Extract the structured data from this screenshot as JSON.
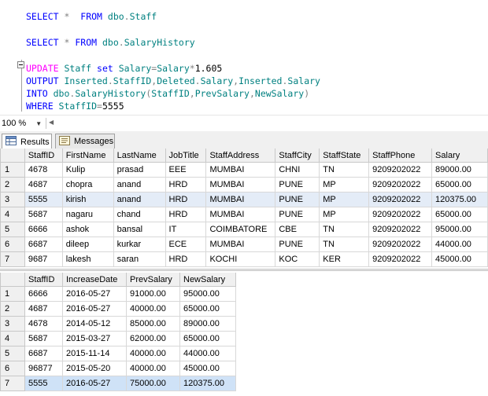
{
  "editor": {
    "lines": [
      {
        "segments": [
          {
            "t": "SELECT ",
            "c": "kw"
          },
          {
            "t": "*",
            "c": "gray"
          },
          {
            "t": "  ",
            "c": ""
          },
          {
            "t": "FROM",
            "c": "kw"
          },
          {
            "t": " dbo",
            "c": "obj"
          },
          {
            "t": ".",
            "c": "gray"
          },
          {
            "t": "Staff",
            "c": "obj"
          }
        ]
      },
      {
        "segments": []
      },
      {
        "segments": [
          {
            "t": "SELECT ",
            "c": "kw"
          },
          {
            "t": "*",
            "c": "gray"
          },
          {
            "t": " ",
            "c": ""
          },
          {
            "t": "FROM",
            "c": "kw"
          },
          {
            "t": " dbo",
            "c": "obj"
          },
          {
            "t": ".",
            "c": "gray"
          },
          {
            "t": "SalaryHistory",
            "c": "obj"
          }
        ]
      },
      {
        "segments": []
      },
      {
        "segments": [
          {
            "t": "UPDATE",
            "c": "pink"
          },
          {
            "t": " Staff ",
            "c": "obj"
          },
          {
            "t": "set",
            "c": "kw"
          },
          {
            "t": " Salary",
            "c": "obj"
          },
          {
            "t": "=",
            "c": "gray"
          },
          {
            "t": "Salary",
            "c": "obj"
          },
          {
            "t": "*",
            "c": "gray"
          },
          {
            "t": "1.605",
            "c": ""
          }
        ]
      },
      {
        "segments": [
          {
            "t": "OUTPUT",
            "c": "kw"
          },
          {
            "t": " Inserted",
            "c": "obj"
          },
          {
            "t": ".",
            "c": "gray"
          },
          {
            "t": "StaffID",
            "c": "obj"
          },
          {
            "t": ",",
            "c": "gray"
          },
          {
            "t": "Deleted",
            "c": "obj"
          },
          {
            "t": ".",
            "c": "gray"
          },
          {
            "t": "Salary",
            "c": "obj"
          },
          {
            "t": ",",
            "c": "gray"
          },
          {
            "t": "Inserted",
            "c": "obj"
          },
          {
            "t": ".",
            "c": "gray"
          },
          {
            "t": "Salary",
            "c": "obj"
          }
        ]
      },
      {
        "segments": [
          {
            "t": "INTO",
            "c": "kw"
          },
          {
            "t": " dbo",
            "c": "obj"
          },
          {
            "t": ".",
            "c": "gray"
          },
          {
            "t": "SalaryHistory",
            "c": "obj"
          },
          {
            "t": "(",
            "c": "gray"
          },
          {
            "t": "StaffID",
            "c": "obj"
          },
          {
            "t": ",",
            "c": "gray"
          },
          {
            "t": "PrevSalary",
            "c": "obj"
          },
          {
            "t": ",",
            "c": "gray"
          },
          {
            "t": "NewSalary",
            "c": "obj"
          },
          {
            "t": ")",
            "c": "gray"
          }
        ]
      },
      {
        "segments": [
          {
            "t": "WHERE",
            "c": "kw"
          },
          {
            "t": " StaffID",
            "c": "obj"
          },
          {
            "t": "=",
            "c": "gray"
          },
          {
            "t": "5555",
            "c": ""
          }
        ]
      }
    ]
  },
  "zoom": {
    "value": "100 %"
  },
  "tabs": {
    "results": "Results",
    "messages": "Messages"
  },
  "grid1": {
    "columns": [
      "StaffID",
      "FirstName",
      "LastName",
      "JobTitle",
      "StaffAddress",
      "StaffCity",
      "StaffState",
      "StaffPhone",
      "Salary"
    ],
    "rows": [
      [
        "1",
        "4678",
        "Kulip",
        "prasad",
        "EEE",
        "MUMBAI",
        "CHNI",
        "TN",
        "9209202022",
        "89000.00"
      ],
      [
        "2",
        "4687",
        "chopra",
        "anand",
        "HRD",
        "MUMBAI",
        "PUNE",
        "MP",
        "9209202022",
        "65000.00"
      ],
      [
        "3",
        "5555",
        "kirish",
        "anand",
        "HRD",
        "MUMBAI",
        "PUNE",
        "MP",
        "9209202022",
        "120375.00"
      ],
      [
        "4",
        "5687",
        "nagaru",
        "chand",
        "HRD",
        "MUMBAI",
        "PUNE",
        "MP",
        "9209202022",
        "65000.00"
      ],
      [
        "5",
        "6666",
        "ashok",
        "bansal",
        "IT",
        "COIMBATORE",
        "CBE",
        "TN",
        "9209202022",
        "95000.00"
      ],
      [
        "6",
        "6687",
        "dileep",
        "kurkar",
        "ECE",
        "MUMBAI",
        "PUNE",
        "TN",
        "9209202022",
        "44000.00"
      ],
      [
        "7",
        "9687",
        "lakesh",
        "saran",
        "HRD",
        "KOCHI",
        "KOC",
        "KER",
        "9209202022",
        "45000.00"
      ]
    ]
  },
  "grid2": {
    "columns": [
      "StaffID",
      "IncreaseDate",
      "PrevSalary",
      "NewSalary"
    ],
    "rows": [
      [
        "1",
        "6666",
        "2016-05-27",
        "91000.00",
        "95000.00"
      ],
      [
        "2",
        "4687",
        "2016-05-27",
        "40000.00",
        "65000.00"
      ],
      [
        "3",
        "4678",
        "2014-05-12",
        "85000.00",
        "89000.00"
      ],
      [
        "4",
        "5687",
        "2015-03-27",
        "62000.00",
        "65000.00"
      ],
      [
        "5",
        "6687",
        "2015-11-14",
        "40000.00",
        "44000.00"
      ],
      [
        "6",
        "96877",
        "2015-05-20",
        "40000.00",
        "45000.00"
      ],
      [
        "7",
        "5555",
        "2016-05-27",
        "75000.00",
        "120375.00"
      ]
    ]
  }
}
